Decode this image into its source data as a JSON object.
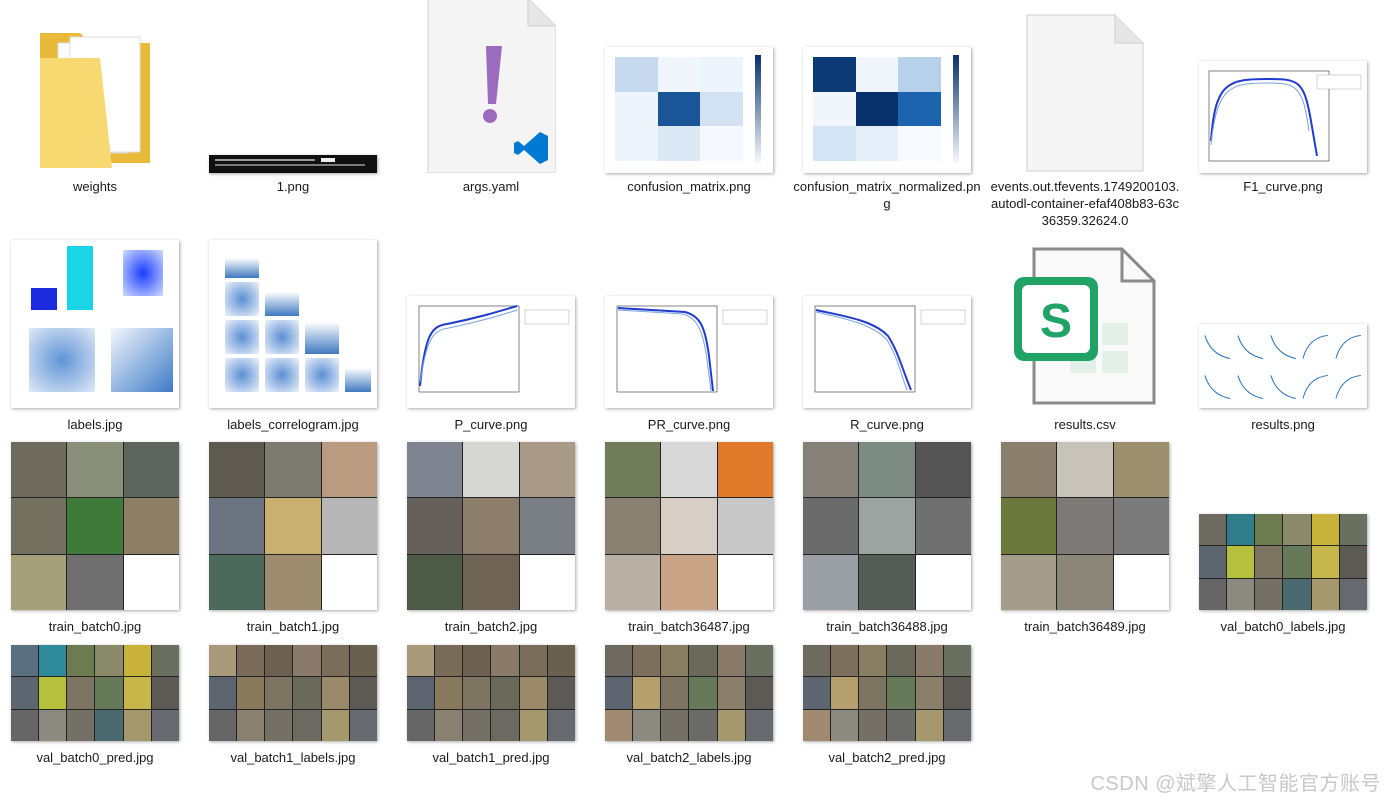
{
  "files": [
    {
      "name": "weights"
    },
    {
      "name": "1.png"
    },
    {
      "name": "args.yaml"
    },
    {
      "name": "confusion_matrix.png"
    },
    {
      "name": "confusion_matrix_normalized.png"
    },
    {
      "name": "events.out.tfevents.1749200103.autodl-container-efaf408b83-63c36359.32624.0"
    },
    {
      "name": "F1_curve.png"
    },
    {
      "name": "labels.jpg"
    },
    {
      "name": "labels_correlogram.jpg"
    },
    {
      "name": "P_curve.png"
    },
    {
      "name": "PR_curve.png"
    },
    {
      "name": "R_curve.png"
    },
    {
      "name": "results.csv"
    },
    {
      "name": "results.png"
    },
    {
      "name": "train_batch0.jpg"
    },
    {
      "name": "train_batch1.jpg"
    },
    {
      "name": "train_batch2.jpg"
    },
    {
      "name": "train_batch36487.jpg"
    },
    {
      "name": "train_batch36488.jpg"
    },
    {
      "name": "train_batch36489.jpg"
    },
    {
      "name": "val_batch0_labels.jpg"
    },
    {
      "name": "val_batch0_pred.jpg"
    },
    {
      "name": "val_batch1_labels.jpg"
    },
    {
      "name": "val_batch1_pred.jpg"
    },
    {
      "name": "val_batch2_labels.jpg"
    },
    {
      "name": "val_batch2_pred.jpg"
    }
  ],
  "watermark": "CSDN @斌擎人工智能官方账号",
  "icons": {
    "csv_brand": "#21a366",
    "vscode": "#0078d4",
    "yaml_mark": "#9b6bbd",
    "folder": "#f3c94e"
  }
}
